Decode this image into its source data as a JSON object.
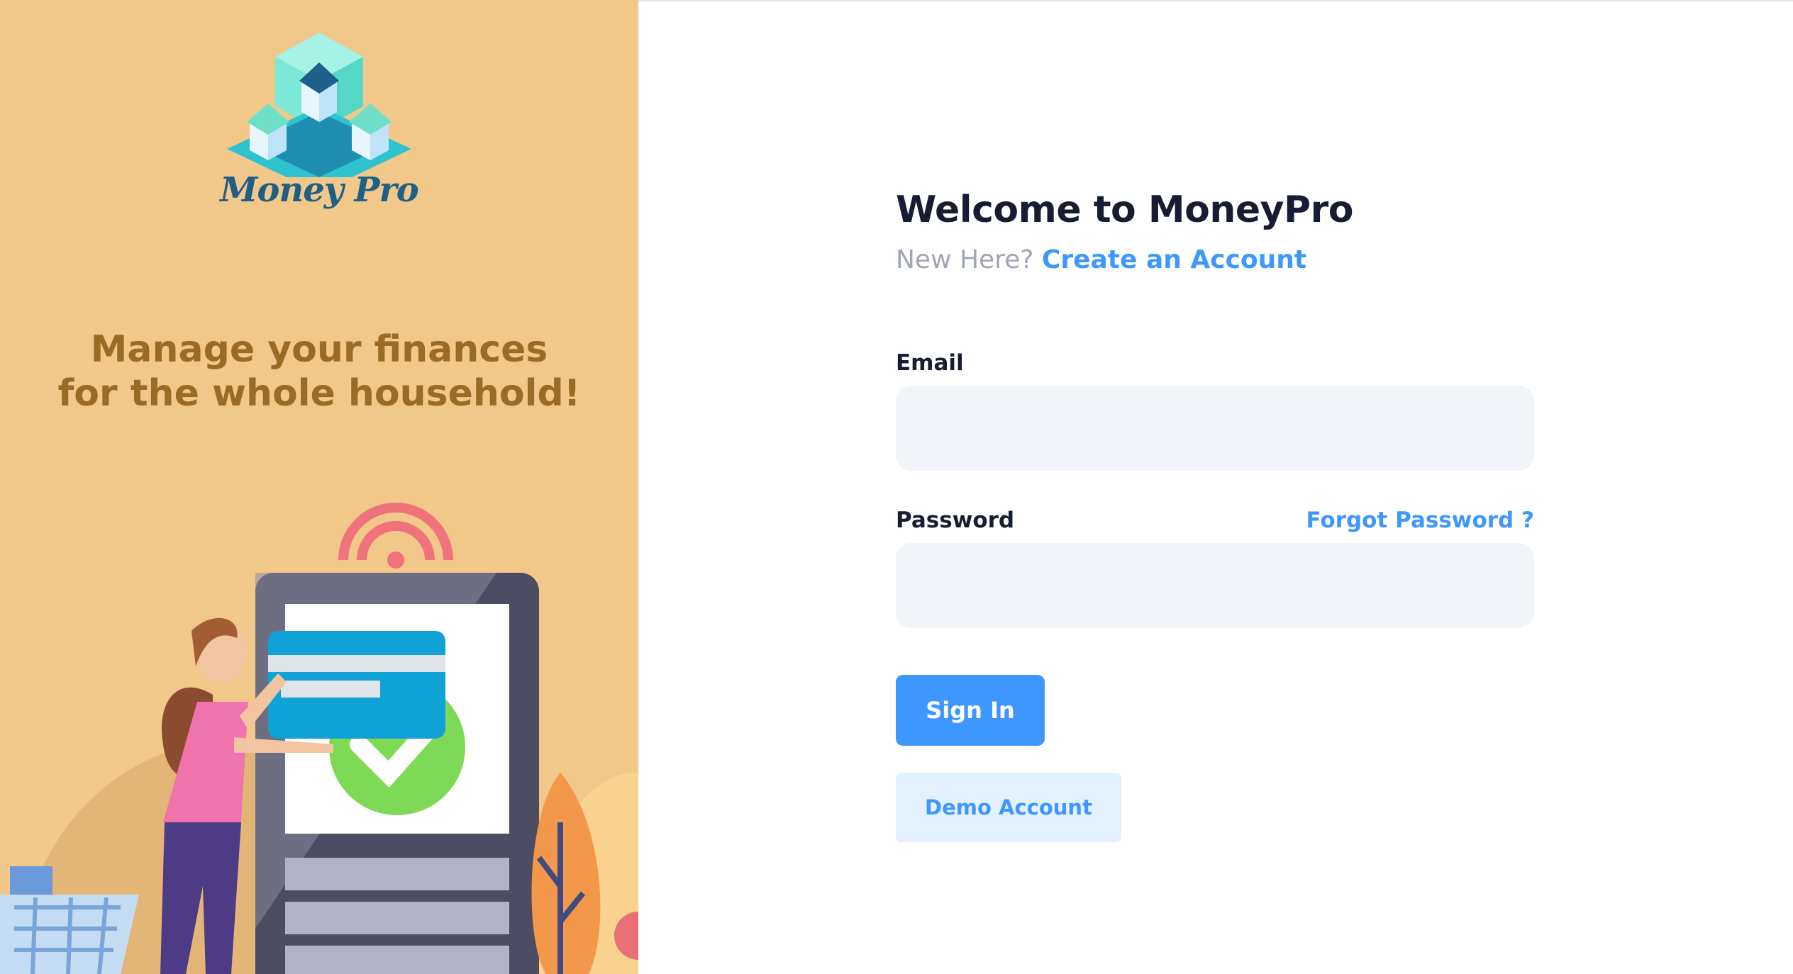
{
  "brand": {
    "logo_text": "Money Pro",
    "logo_icon": "houses-cube-logo"
  },
  "aside": {
    "tagline_line1": "Manage your finances",
    "tagline_line2": "for the whole household!",
    "illustration": "woman-paying-with-card-illustration"
  },
  "login": {
    "title": "Welcome to MoneyPro",
    "new_here": "New Here?",
    "create_account_link": "Create an Account",
    "email_label": "Email",
    "email_value": "",
    "password_label": "Password",
    "password_value": "",
    "forgot_password_link": "Forgot Password ?",
    "sign_in_button": "Sign In",
    "demo_button": "Demo Account"
  },
  "colors": {
    "aside_background": "#f1c78a",
    "tagline": "#9b6a25",
    "title": "#181c32",
    "muted_text": "#a1a5b7",
    "primary": "#3e97ff",
    "input_background": "#f1f4f8",
    "demo_background": "#e4f1ff"
  }
}
